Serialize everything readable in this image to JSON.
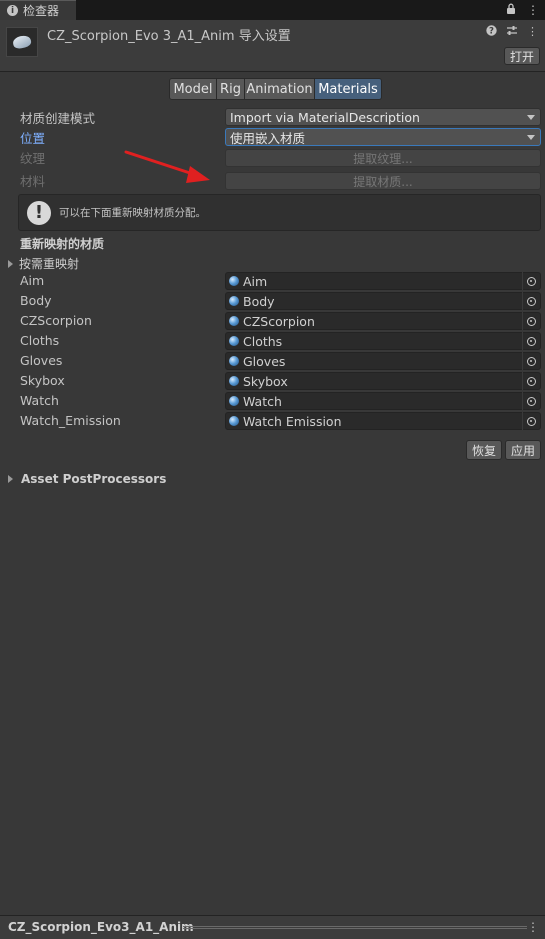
{
  "window": {
    "tab_label": "检查器",
    "tab_icons": [
      "info-icon",
      "lock-icon",
      "more-icon"
    ]
  },
  "header": {
    "title": "CZ_Scorpion_Evo 3_A1_Anim 导入设置",
    "open_label": "打开",
    "icons": [
      "help-icon",
      "settings-sliders-icon",
      "more-icon"
    ]
  },
  "import_tabs": [
    {
      "label": "Model",
      "active": false
    },
    {
      "label": "Rig",
      "active": false
    },
    {
      "label": "Animation",
      "active": false
    },
    {
      "label": "Materials",
      "active": true
    }
  ],
  "material_settings": {
    "creation_mode_label": "材质创建模式",
    "creation_mode_value": "Import via MaterialDescription",
    "location_label": "位置",
    "location_value": "使用嵌入材质",
    "textures_label": "纹理",
    "extract_textures_label": "提取纹理...",
    "materials_label": "材料",
    "extract_materials_label": "提取材质..."
  },
  "help_box": {
    "text": "可以在下面重新映射材质分配。"
  },
  "remapped": {
    "section_title": "重新映射的材质",
    "search_and_remap_label": "按需重映射",
    "items": [
      {
        "label": "Aim",
        "value": "Aim"
      },
      {
        "label": "Body",
        "value": "Body"
      },
      {
        "label": "CZScorpion",
        "value": "CZScorpion"
      },
      {
        "label": "Cloths",
        "value": "Cloths"
      },
      {
        "label": "Gloves",
        "value": "Gloves"
      },
      {
        "label": "Skybox",
        "value": "Skybox"
      },
      {
        "label": "Watch",
        "value": "Watch"
      },
      {
        "label": "Watch_Emission",
        "value": "Watch Emission"
      }
    ]
  },
  "actions": {
    "revert_label": "恢复",
    "apply_label": "应用"
  },
  "postprocessors": {
    "label": "Asset PostProcessors"
  },
  "footer": {
    "title": "CZ_Scorpion_Evo3_A1_Anim"
  },
  "colors": {
    "background": "#383838",
    "active_tab": "#46607c",
    "annotation_arrow": "#e02020",
    "highlight_label": "#7fb0ff"
  }
}
